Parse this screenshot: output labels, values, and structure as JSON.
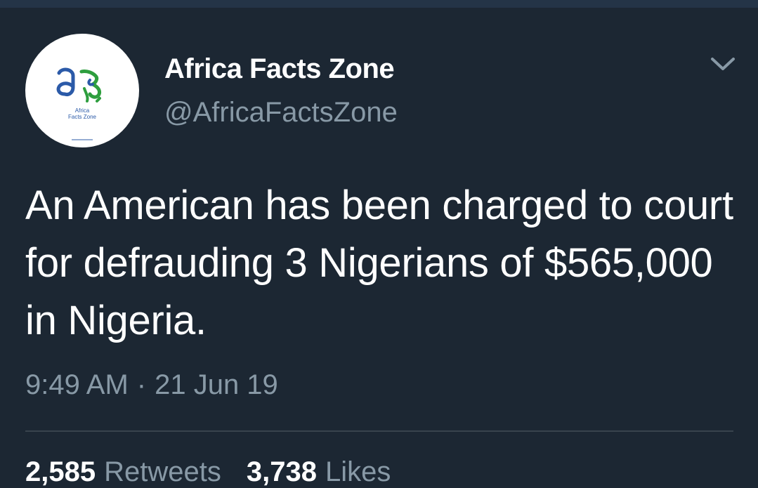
{
  "tweet": {
    "author": {
      "display_name": "Africa Facts Zone",
      "handle": "@AfricaFactsZone",
      "avatar_icon": "africa-facts-zone-logo",
      "avatar_logo_text": "Africa Facts Zone"
    },
    "text": "An American has been charged to court for defrauding 3 Nigerians of $565,000 in Nigeria.",
    "time": "9:49 AM",
    "separator": "·",
    "date": "21 Jun 19",
    "menu_icon": "chevron-down-icon",
    "stats": {
      "retweets_count": "2,585",
      "retweets_label": "Retweets",
      "likes_count": "3,738",
      "likes_label": "Likes"
    }
  },
  "colors": {
    "background": "#1c2733",
    "top_strip": "#243447",
    "primary_text": "#ffffff",
    "secondary_text": "#8899a6",
    "divider": "#38444d",
    "logo_blue": "#2b5aa8",
    "logo_green": "#2e9e3e"
  }
}
